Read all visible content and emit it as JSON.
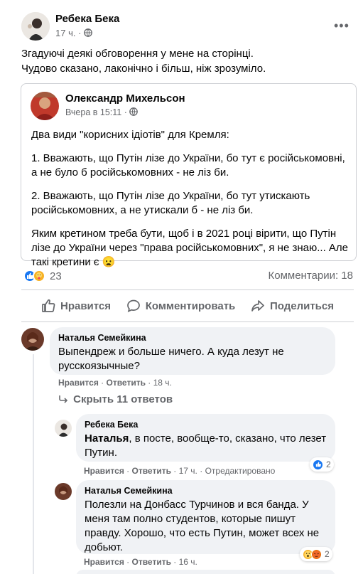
{
  "post": {
    "author": "Ребека Бека",
    "time": "17 ч.",
    "more_icon": "•••",
    "text_line1": "Згадуючі деякі обговорення у мене на сторінці.",
    "text_line2": "Чудово сказано, лаконічно і більш, ніж зрозуміло."
  },
  "shared": {
    "author": "Олександр Михельсон",
    "time": "Вчера в 15:11",
    "p1": "Два види \"корисних ідіотів\" для Кремля:",
    "p2": "1. Вважають, що Путін лізе до України, бо тут є російськомовні, а не було б російськомовних - не ліз би.",
    "p3": "2. Вважають, що Путін лізе до України, бо тут утискають російськомовних, а не утискали б - не ліз би.",
    "p4": "Яким кретином треба бути, щоб і в 2021 році вірити, що Путін лізе до України через \"права російськомовних\", я не знаю... Але такі кретини є",
    "emoji": "😦"
  },
  "stats": {
    "reactions_count": "23",
    "comments": "Комментарии: 18"
  },
  "actions": {
    "like": "Нравится",
    "comment": "Комментировать",
    "share": "Поделиться"
  },
  "comments": [
    {
      "name": "Наталья Семейкина",
      "text": "Выпендреж и больше ничего. А куда лезут не русскоязычные?",
      "like": "Нравится",
      "reply": "Ответить",
      "time": "18 ч."
    }
  ],
  "hide_replies": "Скрыть 11 ответов",
  "replies": [
    {
      "name": "Ребека Бека",
      "mention": "Наталья",
      "text": ", в посте, вообще-то, сказано, что лезет Путин.",
      "like": "Нравится",
      "reply": "Ответить",
      "time": "17 ч.",
      "edited": "Отредактировано",
      "react_count": "2"
    },
    {
      "name": "Наталья Семейкина",
      "text": "Полезли на Донбасс Турчинов и вся банда. У меня там полно студентов, которые пишут правду. Хорошо, что есть Путин, может всех не добьют.",
      "like": "Нравится",
      "reply": "Ответить",
      "time": "16 ч.",
      "react_count": "2"
    }
  ],
  "colors": {
    "like_blue": "#1877f2",
    "care_yellow": "#f7b125",
    "angry_orange": "#e9710f"
  }
}
